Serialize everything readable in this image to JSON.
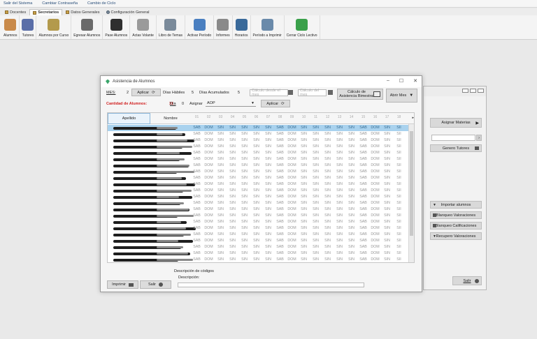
{
  "menubar": {
    "items": [
      "Salir del Sistema",
      "Cambiar Contraseña",
      "Cambio de Ciclo"
    ]
  },
  "tabs": [
    {
      "label": "Docentes",
      "active": false
    },
    {
      "label": "Secretarios",
      "active": true
    },
    {
      "label": "Datos Generales",
      "active": false
    },
    {
      "label": "Configuración General",
      "active": false
    }
  ],
  "ribbon": [
    {
      "label": "Alumnos",
      "icon": "student-icon",
      "color": "#c98a4a"
    },
    {
      "label": "Tutores",
      "icon": "tutor-icon",
      "color": "#5a6ea8"
    },
    {
      "label": "Alumnos por Curso",
      "icon": "group-icon",
      "color": "#b39a4c"
    },
    {
      "label": "Egresar Alumnos",
      "icon": "graduate-icon",
      "color": "#6a6a6a"
    },
    {
      "label": "Pase Alumnos",
      "icon": "transfer-icon",
      "color": "#2f2f2f"
    },
    {
      "label": "Actas Volante",
      "icon": "document-icon",
      "color": "#9a9a9a"
    },
    {
      "label": "Libro de Temas",
      "icon": "book-pen-icon",
      "color": "#7a8a9a"
    },
    {
      "label": "Activar Período",
      "icon": "refresh-icon",
      "color": "#4a7fc0"
    },
    {
      "label": "Informes",
      "icon": "report-icon",
      "color": "#8a8a8a"
    },
    {
      "label": "Horarios",
      "icon": "clock-icon",
      "color": "#3a6a9a"
    },
    {
      "label": "Período a Imprimir",
      "icon": "magnifier-icon",
      "color": "#6a8aaa"
    },
    {
      "label": "Cerrar Ciclo Lectivo",
      "icon": "recycle-icon",
      "color": "#3aa04a"
    }
  ],
  "right_window": {
    "buttons": [
      "Asignar Materias",
      "Genero Tutores",
      "Importar alumnos",
      "Blanqueo Valoraciones",
      "Blanqueo Calificaciones",
      "Recupero Valoraciones",
      "Salir"
    ]
  },
  "dialog": {
    "title": "Asistencia de Alumnos",
    "mes_label": "MES:",
    "mes_value": "2",
    "aplicar_label": "Aplicar",
    "dias_habiles_label": "Días Hábiles",
    "dias_habiles_value": "5",
    "dias_acumulados_label": "Días Acumulados",
    "dias_acumulados_value": "5",
    "calculo_desde_placeholder": "Cálculo desde el mes",
    "calculo_del_mes_placeholder": "Cálculo del mes",
    "calculo_bimestral_label": "Cálculo de Asistencia Bimestral",
    "abrir_mes_label": "Abrir Mes",
    "cantidad_label": "Cantidad de Alumnos:",
    "cantidad_value": "31",
    "dia_label": "Día",
    "dia_value": "0",
    "asignar_label": "Asignar",
    "asignar_value": "AOP",
    "aplicar2_label": "Aplicar",
    "columns": {
      "apellido": "Apellido",
      "nombre": "Nombre"
    },
    "day_headers": [
      "01",
      "02",
      "03",
      "04",
      "05",
      "06",
      "07",
      "08",
      "09",
      "10",
      "11",
      "12",
      "13",
      "14",
      "15",
      "16",
      "17",
      "18"
    ],
    "day_values": [
      "SAB",
      "DOM",
      "SIN",
      "SIN",
      "SIN",
      "SIN",
      "SIN",
      "SAB",
      "DOM",
      "SIN",
      "SIN",
      "SIN",
      "SIN",
      "SIN",
      "SAB",
      "DOM",
      "SIN",
      "SII"
    ],
    "visible_rows": 22,
    "partial_row_text": {
      "apellido": "MONCALERO",
      "nombre": "Milo"
    },
    "descripcion_codigos_label": "Descripción de códigos",
    "descripcion_label": "Descripción:",
    "imprimir_label": "Imprimir",
    "salir_label": "Salir"
  }
}
